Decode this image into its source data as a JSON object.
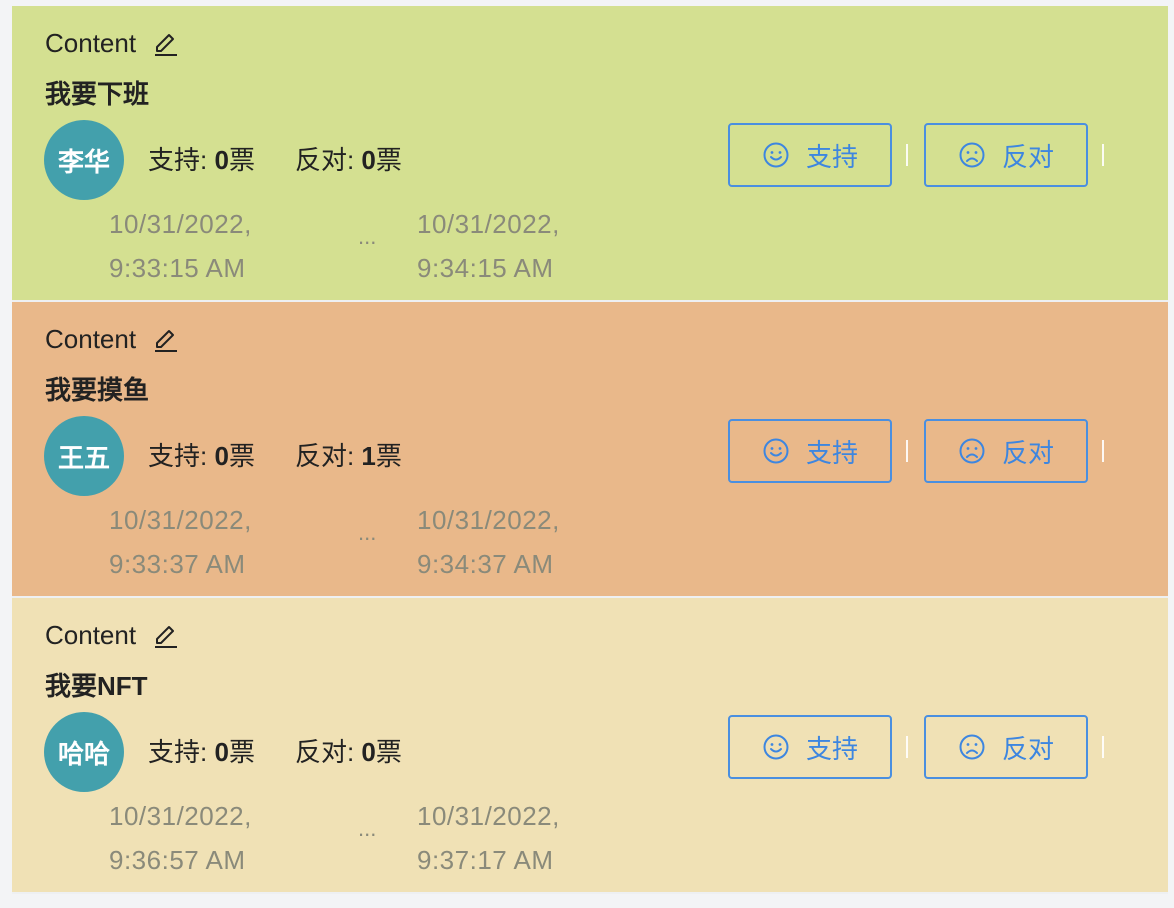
{
  "cards": [
    {
      "header_label": "Content",
      "content": "我要下班",
      "author": "李华",
      "bg_color": "#d4e091",
      "support_label": "支持:",
      "support_count": "0",
      "oppose_label": "反对:",
      "oppose_count": "0",
      "vote_unit": "票",
      "start_date": "10/31/2022,",
      "start_time": "9:33:15 AM",
      "end_date": "10/31/2022,",
      "end_time": "9:34:15 AM",
      "ellipsis": "...",
      "support_button": "支持",
      "oppose_button": "反对"
    },
    {
      "header_label": "Content",
      "content": "我要摸鱼",
      "author": "王五",
      "bg_color": "#e9b88a",
      "support_label": "支持:",
      "support_count": "0",
      "oppose_label": "反对:",
      "oppose_count": "1",
      "vote_unit": "票",
      "start_date": "10/31/2022,",
      "start_time": "9:33:37 AM",
      "end_date": "10/31/2022,",
      "end_time": "9:34:37 AM",
      "ellipsis": "...",
      "support_button": "支持",
      "oppose_button": "反对"
    },
    {
      "header_label": "Content",
      "content": "我要NFT",
      "author": "哈哈",
      "bg_color": "#f0e1b5",
      "support_label": "支持:",
      "support_count": "0",
      "oppose_label": "反对:",
      "oppose_count": "0",
      "vote_unit": "票",
      "start_date": "10/31/2022,",
      "start_time": "9:36:57 AM",
      "end_date": "10/31/2022,",
      "end_time": "9:37:17 AM",
      "ellipsis": "...",
      "support_button": "支持",
      "oppose_button": "反对"
    }
  ],
  "colors": {
    "avatar": "#43a0ac",
    "button_accent": "#3d86e0",
    "timestamp": "#8a8a7a"
  },
  "icons": {
    "edit": "pencil-icon",
    "support": "smile-icon",
    "oppose": "frown-icon"
  }
}
